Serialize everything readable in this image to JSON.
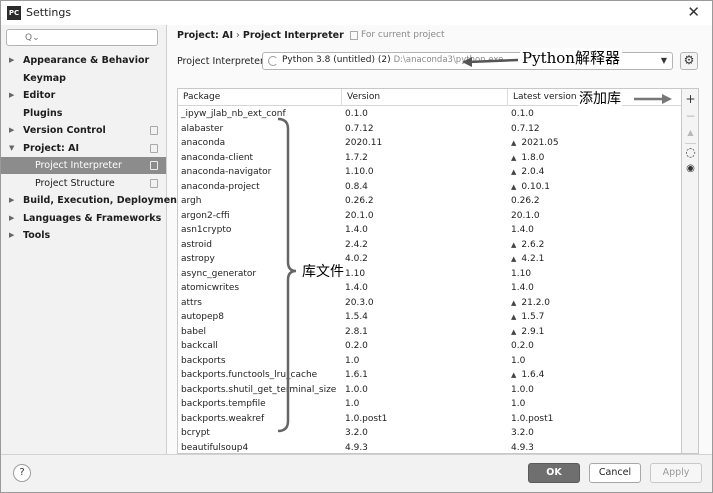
{
  "window": {
    "title": "Settings",
    "logo": "PC"
  },
  "sidebar": {
    "search": {
      "placeholder": "Q⌄"
    },
    "items": [
      {
        "label": "Appearance & Behavior",
        "arrow": "▶",
        "level": 0
      },
      {
        "label": "Keymap",
        "arrow": "",
        "level": 0
      },
      {
        "label": "Editor",
        "arrow": "▶",
        "level": 0
      },
      {
        "label": "Plugins",
        "arrow": "",
        "level": 0
      },
      {
        "label": "Version Control",
        "arrow": "▶",
        "level": 0
      },
      {
        "label": "Project: AI",
        "arrow": "▼",
        "level": 0
      },
      {
        "label": "Project Interpreter",
        "arrow": "",
        "level": 1
      },
      {
        "label": "Project Structure",
        "arrow": "",
        "level": 1
      },
      {
        "label": "Build, Execution, Deployment",
        "arrow": "▶",
        "level": 0
      },
      {
        "label": "Languages & Frameworks",
        "arrow": "▶",
        "level": 0
      },
      {
        "label": "Tools",
        "arrow": "▶",
        "level": 0
      }
    ],
    "selected_item": "Project Interpreter"
  },
  "breadcrumb": {
    "project": "Project: AI",
    "separator": "›",
    "page": "Project Interpreter",
    "scope": "For current project"
  },
  "interpreter": {
    "label": "Project Interpreter:",
    "value": "Python 3.8 (untitled) (2)",
    "path": "D:\\anaconda3\\python.exe"
  },
  "table": {
    "headers": {
      "package": "Package",
      "version": "Version",
      "latest": "Latest version"
    },
    "upgrade_marker": "▲",
    "rows": [
      {
        "package": "_ipyw_jlab_nb_ext_conf",
        "version": "0.1.0",
        "latest": "0.1.0",
        "upgrade": false
      },
      {
        "package": "alabaster",
        "version": "0.7.12",
        "latest": "0.7.12",
        "upgrade": false
      },
      {
        "package": "anaconda",
        "version": "2020.11",
        "latest": "2021.05",
        "upgrade": true
      },
      {
        "package": "anaconda-client",
        "version": "1.7.2",
        "latest": "1.8.0",
        "upgrade": true
      },
      {
        "package": "anaconda-navigator",
        "version": "1.10.0",
        "latest": "2.0.4",
        "upgrade": true
      },
      {
        "package": "anaconda-project",
        "version": "0.8.4",
        "latest": "0.10.1",
        "upgrade": true
      },
      {
        "package": "argh",
        "version": "0.26.2",
        "latest": "0.26.2",
        "upgrade": false
      },
      {
        "package": "argon2-cffi",
        "version": "20.1.0",
        "latest": "20.1.0",
        "upgrade": false
      },
      {
        "package": "asn1crypto",
        "version": "1.4.0",
        "latest": "1.4.0",
        "upgrade": false
      },
      {
        "package": "astroid",
        "version": "2.4.2",
        "latest": "2.6.2",
        "upgrade": true
      },
      {
        "package": "astropy",
        "version": "4.0.2",
        "latest": "4.2.1",
        "upgrade": true
      },
      {
        "package": "async_generator",
        "version": "1.10",
        "latest": "1.10",
        "upgrade": false
      },
      {
        "package": "atomicwrites",
        "version": "1.4.0",
        "latest": "1.4.0",
        "upgrade": false
      },
      {
        "package": "attrs",
        "version": "20.3.0",
        "latest": "21.2.0",
        "upgrade": true
      },
      {
        "package": "autopep8",
        "version": "1.5.4",
        "latest": "1.5.7",
        "upgrade": true
      },
      {
        "package": "babel",
        "version": "2.8.1",
        "latest": "2.9.1",
        "upgrade": true
      },
      {
        "package": "backcall",
        "version": "0.2.0",
        "latest": "0.2.0",
        "upgrade": false
      },
      {
        "package": "backports",
        "version": "1.0",
        "latest": "1.0",
        "upgrade": false
      },
      {
        "package": "backports.functools_lru_cache",
        "version": "1.6.1",
        "latest": "1.6.4",
        "upgrade": true
      },
      {
        "package": "backports.shutil_get_terminal_size",
        "version": "1.0.0",
        "latest": "1.0.0",
        "upgrade": false
      },
      {
        "package": "backports.tempfile",
        "version": "1.0",
        "latest": "1.0",
        "upgrade": false
      },
      {
        "package": "backports.weakref",
        "version": "1.0.post1",
        "latest": "1.0.post1",
        "upgrade": false
      },
      {
        "package": "bcrypt",
        "version": "3.2.0",
        "latest": "3.2.0",
        "upgrade": false
      },
      {
        "package": "beautifulsoup4",
        "version": "4.9.3",
        "latest": "4.9.3",
        "upgrade": false
      }
    ]
  },
  "toolbar": {
    "add": "+",
    "remove": "−",
    "upgrade": "▲",
    "conda": "◌",
    "show": "◉"
  },
  "buttons": {
    "help": "?",
    "ok": "OK",
    "cancel": "Cancel",
    "apply": "Apply"
  },
  "annotations": {
    "interpreter": "Python解释器",
    "add_package": "添加库",
    "library_files": "库文件"
  },
  "colors": {
    "selected": "#8c8c8c",
    "primary_button": "#6f6f6f",
    "window_bg": "#fafafa"
  }
}
